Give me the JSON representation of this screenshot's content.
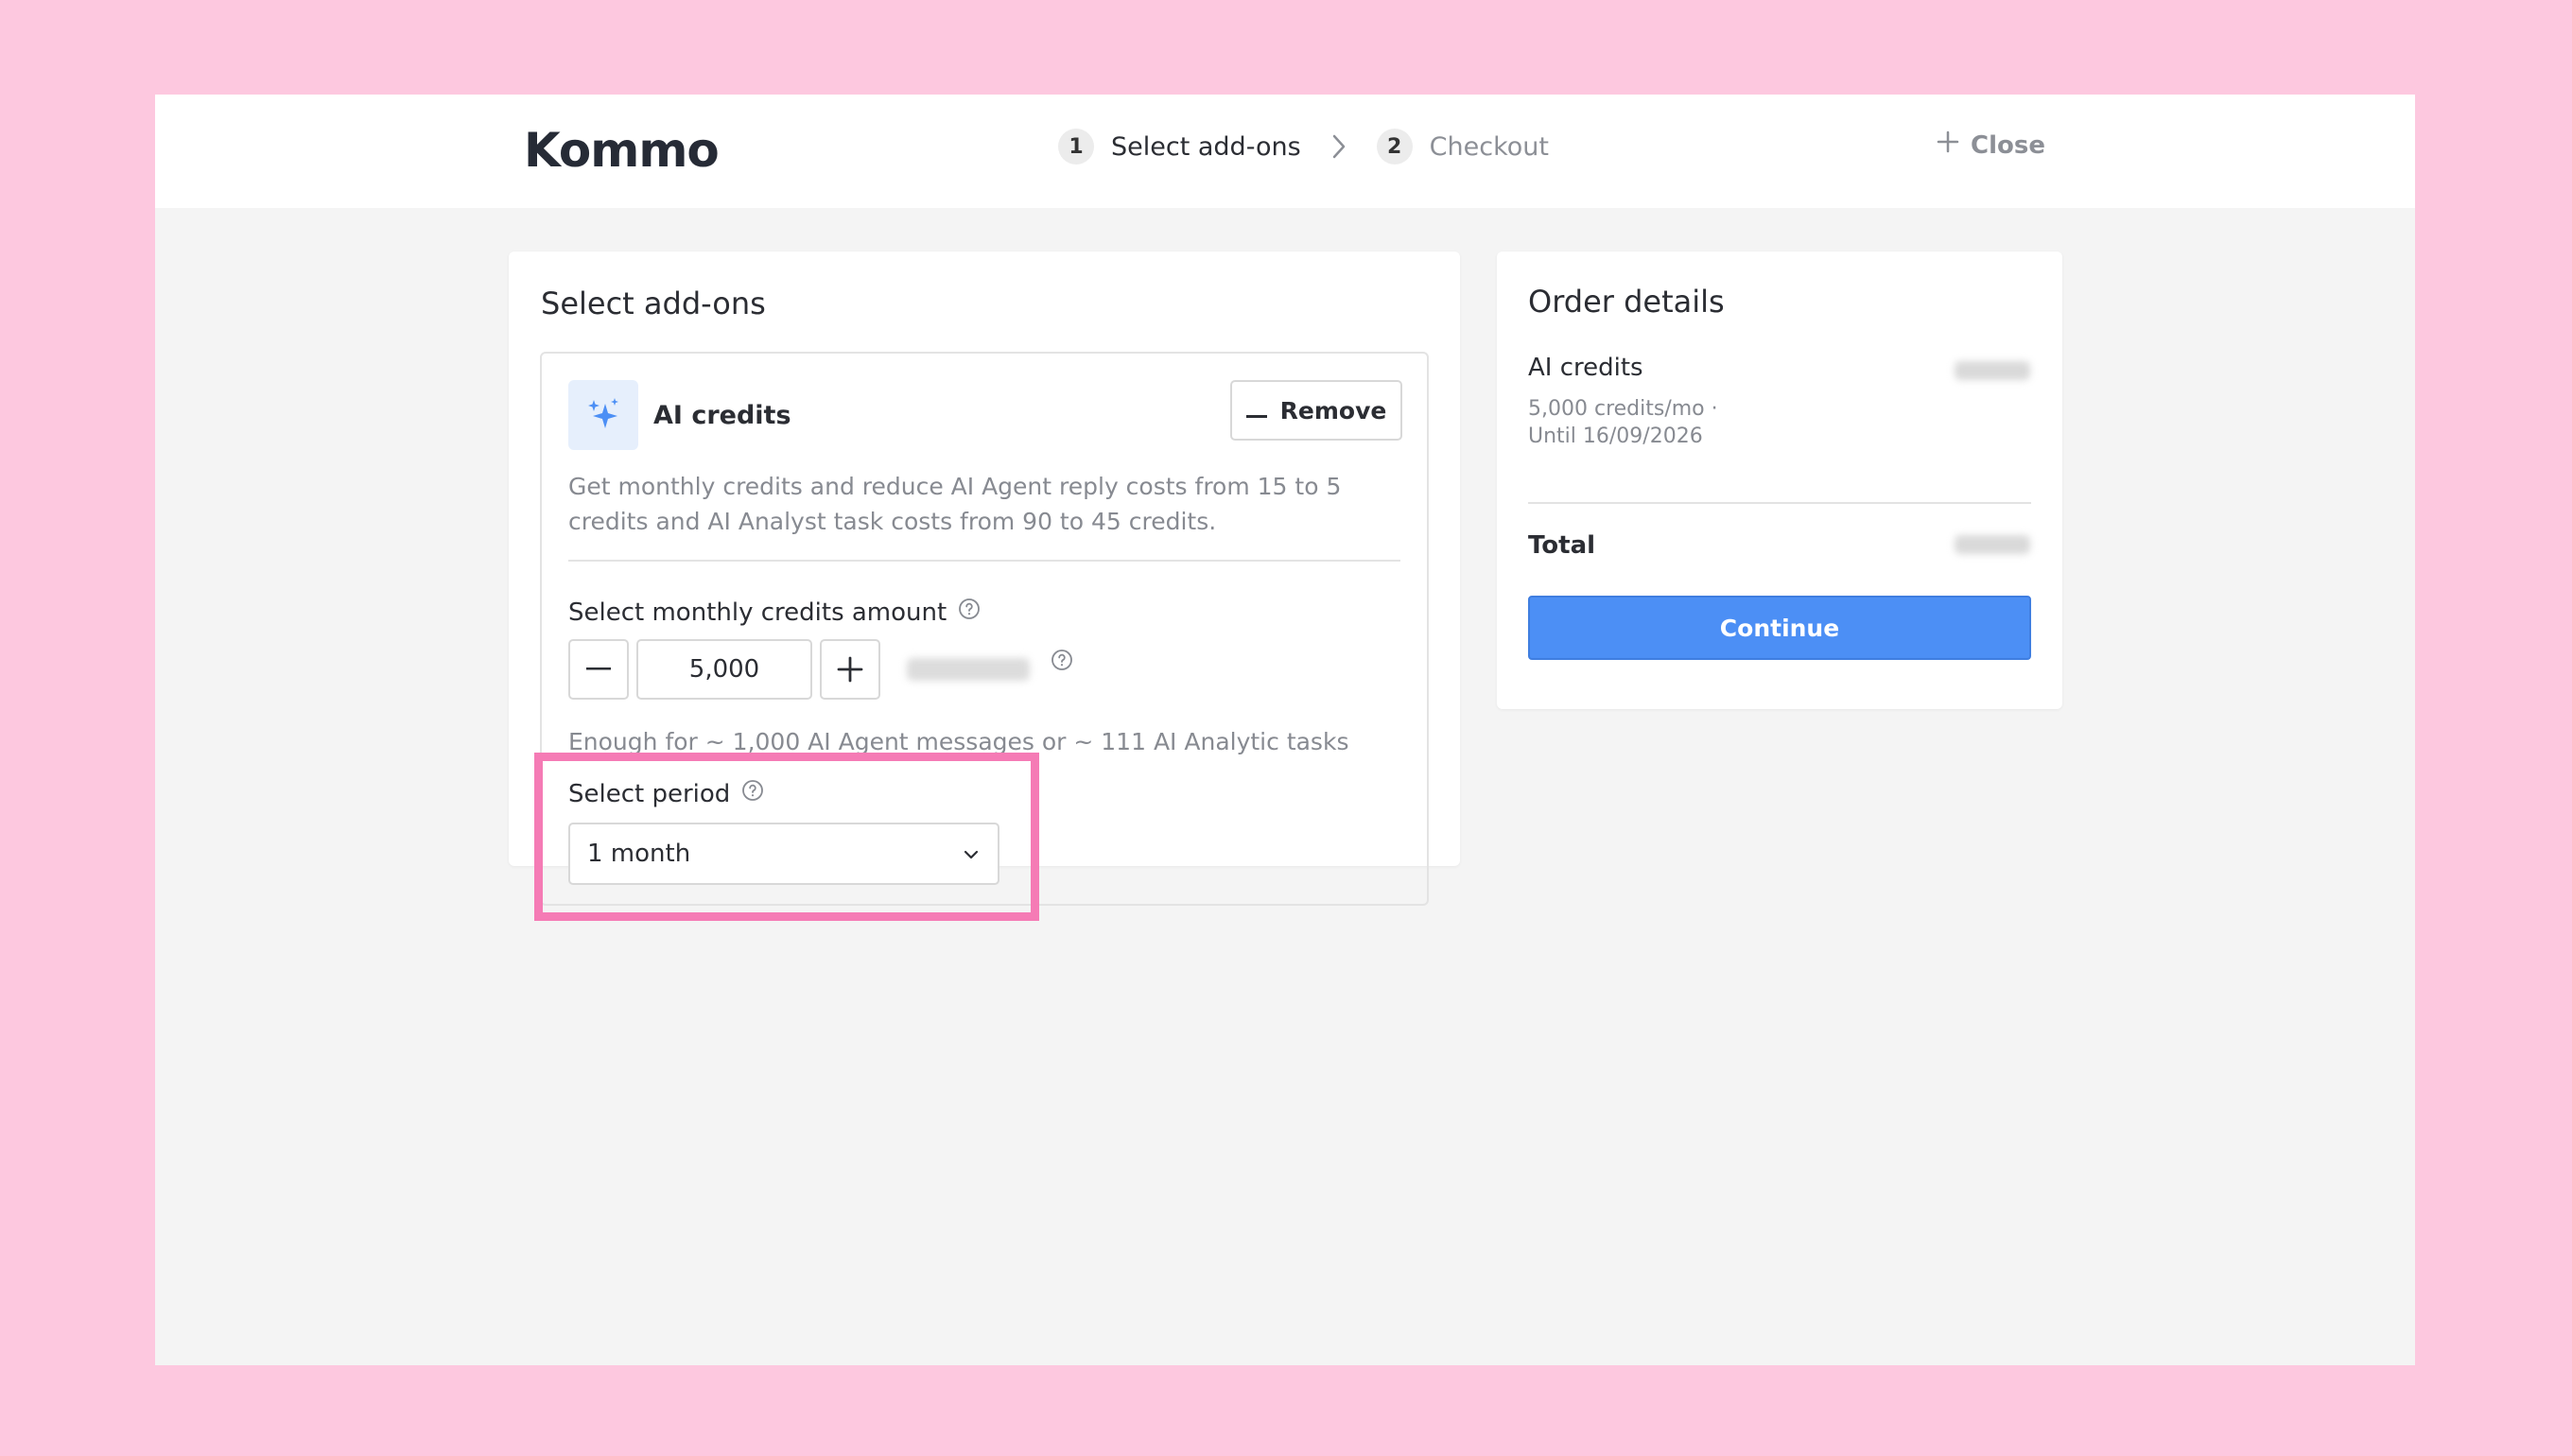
{
  "colors": {
    "frame_background": "#fdc8df",
    "window_background": "#f4f4f4",
    "accent": "#4c8ff5",
    "highlight": "#f57bb5",
    "muted_text": "#878a91"
  },
  "header": {
    "logo_text": "Kommo",
    "steps": [
      {
        "number": "1",
        "label": "Select add-ons",
        "active": true
      },
      {
        "number": "2",
        "label": "Checkout",
        "active": false
      }
    ],
    "step_separator_icon": "chevron-right-icon",
    "close_label": "Close",
    "close_icon": "plus-icon"
  },
  "addons": {
    "title": "Select add-ons",
    "item": {
      "icon": "sparkles-icon",
      "name": "AI credits",
      "remove_label": "Remove",
      "description": "Get monthly credits and reduce AI Agent reply costs from 15 to 5 credits and AI Analyst task costs from 90 to 45 credits.",
      "credits_label": "Select monthly credits amount",
      "credits_value": "5,000",
      "enough_text": "Enough for ~ 1,000 AI Agent messages or ~ 111 AI Analytic tasks",
      "period_label": "Select period",
      "period_value": "1 month"
    }
  },
  "order": {
    "title": "Order details",
    "item_name": "AI credits",
    "item_detail_line1": "5,000 credits/mo ·",
    "item_detail_line2": "Until 16/09/2026",
    "total_label": "Total",
    "continue_label": "Continue"
  }
}
